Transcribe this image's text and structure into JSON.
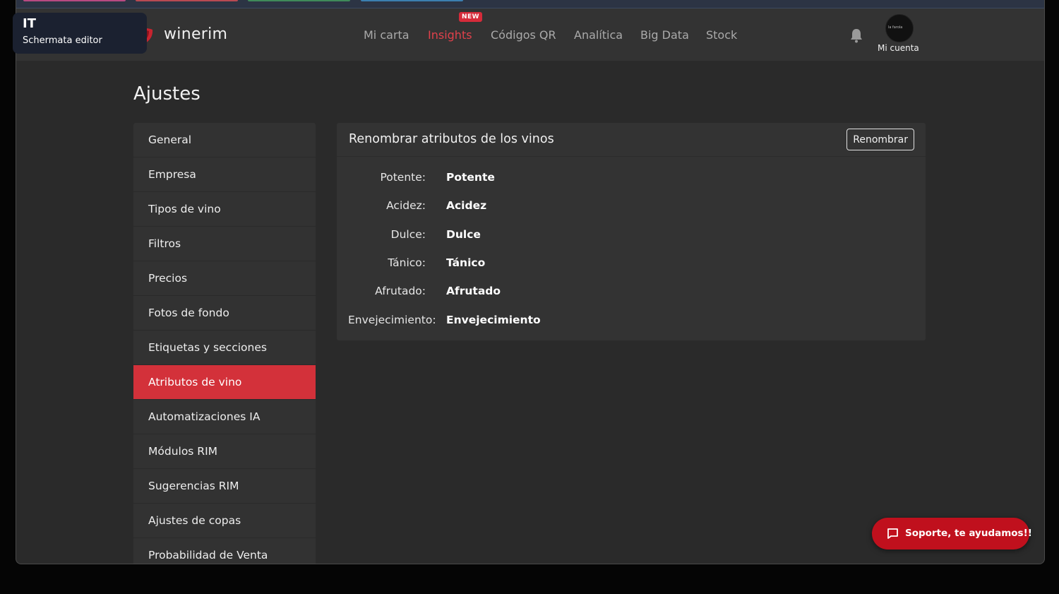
{
  "language_tip": {
    "code": "IT",
    "label": "Schermata editor"
  },
  "header": {
    "brand": "winerim",
    "nav": [
      {
        "label": "Mi carta",
        "active": false
      },
      {
        "label": "Insights",
        "active": true,
        "badge": "NEW"
      },
      {
        "label": "Códigos QR",
        "active": false
      },
      {
        "label": "Analítica",
        "active": false
      },
      {
        "label": "Big Data",
        "active": false
      },
      {
        "label": "Stock",
        "active": false
      }
    ],
    "notifications_icon": "bell-icon",
    "account": {
      "label": "Mi cuenta",
      "avatar_text": "la farola"
    }
  },
  "page": {
    "title": "Ajustes"
  },
  "sidebar": {
    "items": [
      {
        "label": "General",
        "active": false
      },
      {
        "label": "Empresa",
        "active": false
      },
      {
        "label": "Tipos de vino",
        "active": false
      },
      {
        "label": "Filtros",
        "active": false
      },
      {
        "label": "Precios",
        "active": false
      },
      {
        "label": "Fotos de fondo",
        "active": false
      },
      {
        "label": "Etiquetas y secciones",
        "active": false
      },
      {
        "label": "Atributos de vino",
        "active": true
      },
      {
        "label": "Automatizaciones IA",
        "active": false
      },
      {
        "label": "Módulos RIM",
        "active": false
      },
      {
        "label": "Sugerencias RIM",
        "active": false
      },
      {
        "label": "Ajustes de copas",
        "active": false
      },
      {
        "label": "Probabilidad de Venta",
        "active": false
      }
    ]
  },
  "panel": {
    "title": "Renombrar atributos de los vinos",
    "button_label": "Renombrar",
    "attributes": [
      {
        "label": "Potente:",
        "value": "Potente"
      },
      {
        "label": "Acidez:",
        "value": "Acidez"
      },
      {
        "label": "Dulce:",
        "value": "Dulce"
      },
      {
        "label": "Tánico:",
        "value": "Tánico"
      },
      {
        "label": "Afrutado:",
        "value": "Afrutado"
      },
      {
        "label": "Envejecimiento:",
        "value": "Envejecimiento"
      }
    ]
  },
  "support_button": {
    "label": "Soporte, te ayudamos!!",
    "icon": "chat-icon"
  },
  "colors": {
    "accent": "#d3313a",
    "background": "#2a2a2a",
    "card": "#333333",
    "support": "#c0101d"
  }
}
